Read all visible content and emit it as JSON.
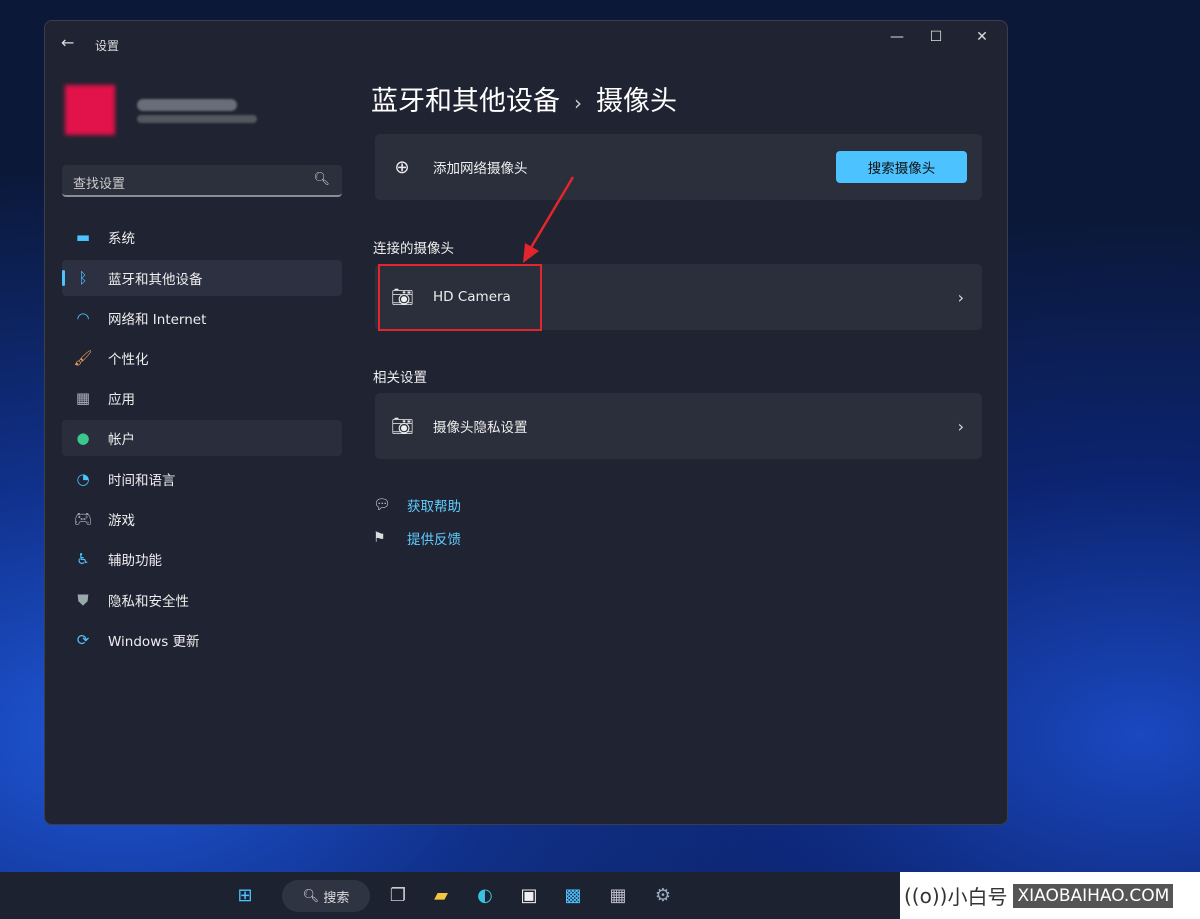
{
  "window": {
    "title": "设置",
    "minimize_icon": "minimize",
    "maximize_icon": "maximize",
    "close_icon": "close"
  },
  "search": {
    "placeholder": "查找设置"
  },
  "sidebar": {
    "items": [
      {
        "label": "系统",
        "icon": "monitor"
      },
      {
        "label": "蓝牙和其他设备",
        "icon": "bluetooth",
        "active": true
      },
      {
        "label": "网络和 Internet",
        "icon": "wifi"
      },
      {
        "label": "个性化",
        "icon": "brush"
      },
      {
        "label": "应用",
        "icon": "apps"
      },
      {
        "label": "帐户",
        "icon": "person"
      },
      {
        "label": "时间和语言",
        "icon": "globe-clock"
      },
      {
        "label": "游戏",
        "icon": "gamepad"
      },
      {
        "label": "辅助功能",
        "icon": "accessibility"
      },
      {
        "label": "隐私和安全性",
        "icon": "shield"
      },
      {
        "label": "Windows 更新",
        "icon": "update"
      }
    ]
  },
  "main": {
    "breadcrumb_parent": "蓝牙和其他设备",
    "breadcrumb_sep": "›",
    "breadcrumb_current": "摄像头",
    "add_camera_label": "添加网络摄像头",
    "search_camera_button": "搜索摄像头",
    "connected_heading": "连接的摄像头",
    "camera_name": "HD Camera",
    "related_heading": "相关设置",
    "privacy_label": "摄像头隐私设置",
    "help_link": "获取帮助",
    "feedback_link": "提供反馈"
  },
  "taskbar": {
    "search_label": "搜索"
  },
  "logo": {
    "text": "小白号",
    "domain": "XIAOBAIHAO.COM"
  },
  "colors": {
    "accent": "#4cc2ff",
    "link": "#60cdff",
    "annotation": "#e3262b"
  }
}
